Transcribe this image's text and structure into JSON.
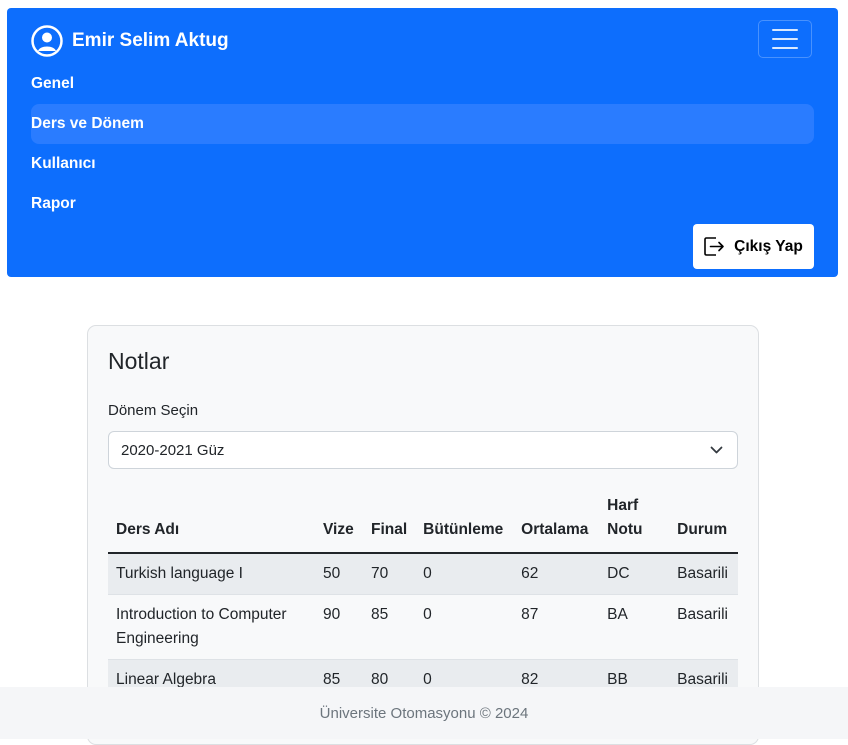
{
  "navbar": {
    "user_name": "Emir Selim Aktug",
    "brand_color": "#0d6efd",
    "items": [
      {
        "label": "Genel",
        "active": false
      },
      {
        "label": "Ders ve Dönem",
        "active": true
      },
      {
        "label": "Kullanıcı",
        "active": false
      },
      {
        "label": "Rapor",
        "active": false
      }
    ],
    "logout_label": "Çıkış Yap"
  },
  "card": {
    "title": "Notlar",
    "select_label": "Dönem Seçin",
    "selected_term": "2020-2021 Güz"
  },
  "table": {
    "headers": [
      "Ders Adı",
      "Vize",
      "Final",
      "Bütünleme",
      "Ortalama",
      "Harf Notu",
      "Durum"
    ],
    "rows": [
      [
        "Turkish language I",
        "50",
        "70",
        "0",
        "62",
        "DC",
        "Basarili"
      ],
      [
        "Introduction to Computer Engineering",
        "90",
        "85",
        "0",
        "87",
        "BA",
        "Basarili"
      ],
      [
        "Linear Algebra",
        "85",
        "80",
        "0",
        "82",
        "BB",
        "Basarili"
      ]
    ]
  },
  "footer": {
    "text": "Üniversite Otomasyonu © 2024"
  }
}
